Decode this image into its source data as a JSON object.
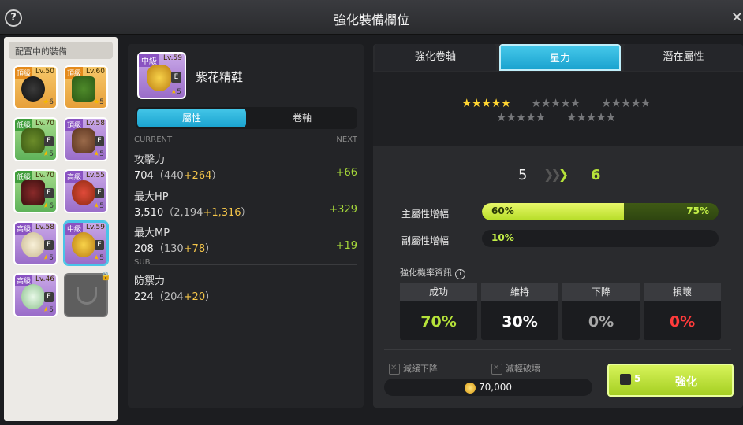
{
  "window": {
    "title": "強化裝備欄位"
  },
  "equipped": {
    "title": "配置中的裝備",
    "slots": [
      {
        "tier": "頂級",
        "level": "Lv.50",
        "stars": "6"
      },
      {
        "tier": "頂級",
        "level": "Lv.60",
        "stars": "5"
      },
      {
        "tier": "低級",
        "level": "Lv.70",
        "stars": "5",
        "e": "E"
      },
      {
        "tier": "頂級",
        "level": "Lv.58",
        "stars": "5",
        "e": "E"
      },
      {
        "tier": "低級",
        "level": "Lv.70",
        "stars": "6",
        "e": "E"
      },
      {
        "tier": "高級",
        "level": "Lv.55",
        "stars": "5",
        "e": "E"
      },
      {
        "tier": "高級",
        "level": "Lv.58",
        "stars": "5",
        "e": "E"
      },
      {
        "tier": "中級",
        "level": "Lv.59",
        "stars": "5",
        "e": "E"
      },
      {
        "tier": "高級",
        "level": "Lv.46",
        "stars": "5",
        "e": "E"
      }
    ]
  },
  "item": {
    "tier": "中級",
    "level": "Lv.59",
    "e": "E",
    "stars": "5",
    "name": "紫花精鞋"
  },
  "subtabs": {
    "attributes": "屬性",
    "scroll": "卷軸"
  },
  "stats": {
    "current_header": "CURRENT",
    "next_header": "NEXT",
    "sub_header": "SUB",
    "rows": [
      {
        "name": "攻擊力",
        "value": "704",
        "base": "（440",
        "bonus": "+264",
        "close": "）",
        "next": "+66"
      },
      {
        "name": "最大HP",
        "value": "3,510",
        "base": "（2,194",
        "bonus": "+1,316",
        "close": "）",
        "next": "+329"
      },
      {
        "name": "最大MP",
        "value": "208",
        "base": "（130",
        "bonus": "+78",
        "close": "）",
        "next": "+19"
      }
    ],
    "sub_rows": [
      {
        "name": "防禦力",
        "value": "224",
        "base": "（204",
        "bonus": "+20",
        "close": "）"
      }
    ]
  },
  "tabs": {
    "scroll": "強化卷軸",
    "starforce": "星力",
    "potential": "潛在屬性"
  },
  "starforce": {
    "stars_filled": 5,
    "stars_total": 25,
    "current_level": "5",
    "next_level": "6",
    "main_label": "主屬性增幅",
    "main_current": "60%",
    "main_next": "75%",
    "main_current_fraction": 0.6,
    "main_next_fraction": 0.75,
    "sub_label": "副屬性增幅",
    "sub_current": "10%"
  },
  "probability": {
    "title": "強化機率資訊",
    "success_label": "成功",
    "success_value": "70%",
    "maintain_label": "維持",
    "maintain_value": "30%",
    "decrease_label": "下降",
    "decrease_value": "0%",
    "destroy_label": "損壞",
    "destroy_value": "0%"
  },
  "options": {
    "slow_decrease": "減緩下降",
    "reduce_destroy": "減輕破壞"
  },
  "cost": {
    "mesos": "70,000"
  },
  "enhance": {
    "scroll_count": "5",
    "label": "強化"
  },
  "colors": {
    "accent": "#1aa3cf",
    "success": "#b6e23a",
    "destroy": "#ff3b3b",
    "bonus": "#f5c64a"
  }
}
